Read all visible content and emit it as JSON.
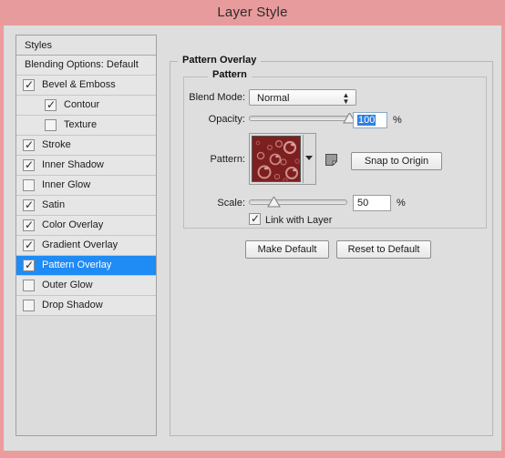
{
  "window": {
    "title": "Layer Style",
    "titlebar_color": "#e89b9c",
    "body_color": "#dedede",
    "accent_selection": "#1f8bf4"
  },
  "styles_panel": {
    "header": "Styles",
    "items": [
      {
        "label": "Blending Options: Default",
        "checkbox": "none",
        "checked": false,
        "indent": 0,
        "selected": false
      },
      {
        "label": "Bevel & Emboss",
        "checkbox": "checkbox",
        "checked": true,
        "indent": 0,
        "selected": false
      },
      {
        "label": "Contour",
        "checkbox": "checkbox",
        "checked": true,
        "indent": 1,
        "selected": false
      },
      {
        "label": "Texture",
        "checkbox": "checkbox",
        "checked": false,
        "indent": 1,
        "selected": false
      },
      {
        "label": "Stroke",
        "checkbox": "checkbox",
        "checked": true,
        "indent": 0,
        "selected": false
      },
      {
        "label": "Inner Shadow",
        "checkbox": "checkbox",
        "checked": true,
        "indent": 0,
        "selected": false
      },
      {
        "label": "Inner Glow",
        "checkbox": "checkbox",
        "checked": false,
        "indent": 0,
        "selected": false
      },
      {
        "label": "Satin",
        "checkbox": "checkbox",
        "checked": true,
        "indent": 0,
        "selected": false
      },
      {
        "label": "Color Overlay",
        "checkbox": "checkbox",
        "checked": true,
        "indent": 0,
        "selected": false
      },
      {
        "label": "Gradient Overlay",
        "checkbox": "checkbox",
        "checked": true,
        "indent": 0,
        "selected": false
      },
      {
        "label": "Pattern Overlay",
        "checkbox": "checkbox",
        "checked": true,
        "indent": 0,
        "selected": true
      },
      {
        "label": "Outer Glow",
        "checkbox": "checkbox",
        "checked": false,
        "indent": 0,
        "selected": false
      },
      {
        "label": "Drop Shadow",
        "checkbox": "checkbox",
        "checked": false,
        "indent": 0,
        "selected": false
      }
    ]
  },
  "main": {
    "group_title": "Pattern Overlay",
    "subgroup_title": "Pattern",
    "blend_mode": {
      "label": "Blend Mode:",
      "value": "Normal"
    },
    "opacity": {
      "label": "Opacity:",
      "value": "100",
      "unit": "%",
      "slider_percent": 100,
      "value_selected": true
    },
    "pattern": {
      "label": "Pattern:",
      "swatch_base_color": "#7d1f1f",
      "swatch_highlight_color": "#d79a9a",
      "preset_icon": "new-preset-icon",
      "snap_button": "Snap to Origin"
    },
    "scale": {
      "label": "Scale:",
      "value": "50",
      "unit": "%",
      "slider_percent": 25
    },
    "link_with_layer": {
      "label": "Link with Layer",
      "checked": true
    },
    "buttons": {
      "make_default": "Make Default",
      "reset_to_default": "Reset to Default"
    }
  }
}
